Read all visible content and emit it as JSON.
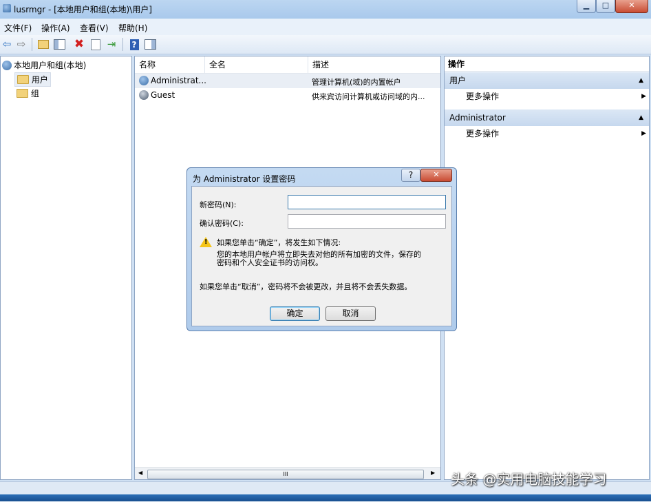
{
  "window": {
    "title": "lusrmgr - [本地用户和组(本地)\\用户]",
    "minimize_glyph": "▁",
    "maximize_glyph": "□",
    "close_glyph": "✕"
  },
  "menu": [
    "文件(F)",
    "操作(A)",
    "查看(V)",
    "帮助(H)"
  ],
  "toolbar_icons": [
    "back-icon",
    "forward-icon",
    "up-folder-icon",
    "show-hide-tree-icon",
    "delete-icon",
    "properties-icon",
    "export-icon",
    "help-icon",
    "show-hide-action-icon"
  ],
  "tree": {
    "root": "本地用户和组(本地)",
    "children": [
      {
        "label": "用户",
        "selected": true
      },
      {
        "label": "组",
        "selected": false
      }
    ]
  },
  "list": {
    "columns": [
      "名称",
      "全名",
      "描述"
    ],
    "rows": [
      {
        "name": "Administrat...",
        "fullname": "",
        "desc": "管理计算机(域)的内置帐户"
      },
      {
        "name": "Guest",
        "fullname": "",
        "desc": "供来宾访问计算机或访问域的内..."
      }
    ],
    "hscroll_grip": "III"
  },
  "actions": {
    "header": "操作",
    "sections": [
      {
        "title": "用户",
        "item": "更多操作"
      },
      {
        "title": "Administrator",
        "item": "更多操作"
      }
    ]
  },
  "dialog": {
    "title": "为 Administrator 设置密码",
    "help_glyph": "?",
    "close_glyph": "✕",
    "new_password_label": "新密码(N):",
    "new_password_value": "",
    "confirm_password_label": "确认密码(C):",
    "confirm_password_value": "",
    "warning_title": "如果您单击“确定”，将发生如下情况:",
    "warning_line1": "您的本地用户帐户将立即失去对他的所有加密的文件，保存的",
    "warning_line2": "密码和个人安全证书的访问权。",
    "cancel_note": "如果您单击“取消”，密码将不会被更改，并且将不会丢失数据。",
    "ok_label": "确定",
    "cancel_label": "取消"
  },
  "watermark": "头条 @实用电脑技能学习",
  "colors": {
    "accent": "#3a6ea8",
    "warning": "#f5c518"
  }
}
